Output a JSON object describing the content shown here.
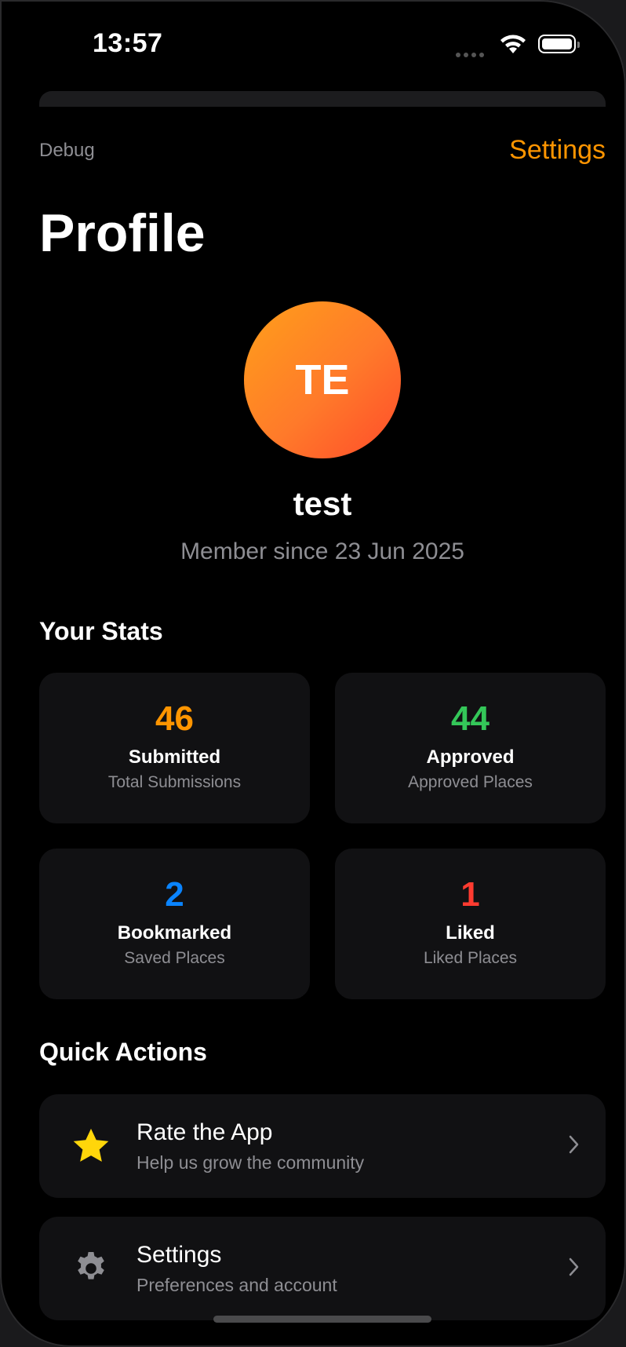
{
  "status_bar": {
    "time": "13:57"
  },
  "nav": {
    "debug_label": "Debug",
    "settings_label": "Settings"
  },
  "page": {
    "title": "Profile"
  },
  "profile": {
    "initials": "TE",
    "username": "test",
    "member_since": "Member since 23 Jun 2025"
  },
  "stats": {
    "heading": "Your Stats",
    "items": [
      {
        "value": "46",
        "label": "Submitted",
        "sub": "Total Submissions",
        "color": "#ff9500"
      },
      {
        "value": "44",
        "label": "Approved",
        "sub": "Approved Places",
        "color": "#34c759"
      },
      {
        "value": "2",
        "label": "Bookmarked",
        "sub": "Saved Places",
        "color": "#0a84ff"
      },
      {
        "value": "1",
        "label": "Liked",
        "sub": "Liked Places",
        "color": "#ff3b30"
      }
    ]
  },
  "quick_actions": {
    "heading": "Quick Actions",
    "items": [
      {
        "title": "Rate the App",
        "subtitle": "Help us grow the community",
        "icon": "star-icon"
      },
      {
        "title": "Settings",
        "subtitle": "Preferences and account",
        "icon": "gear-icon"
      }
    ]
  },
  "colors": {
    "accent": "#ff9500",
    "background": "#000000",
    "card": "#111113"
  }
}
